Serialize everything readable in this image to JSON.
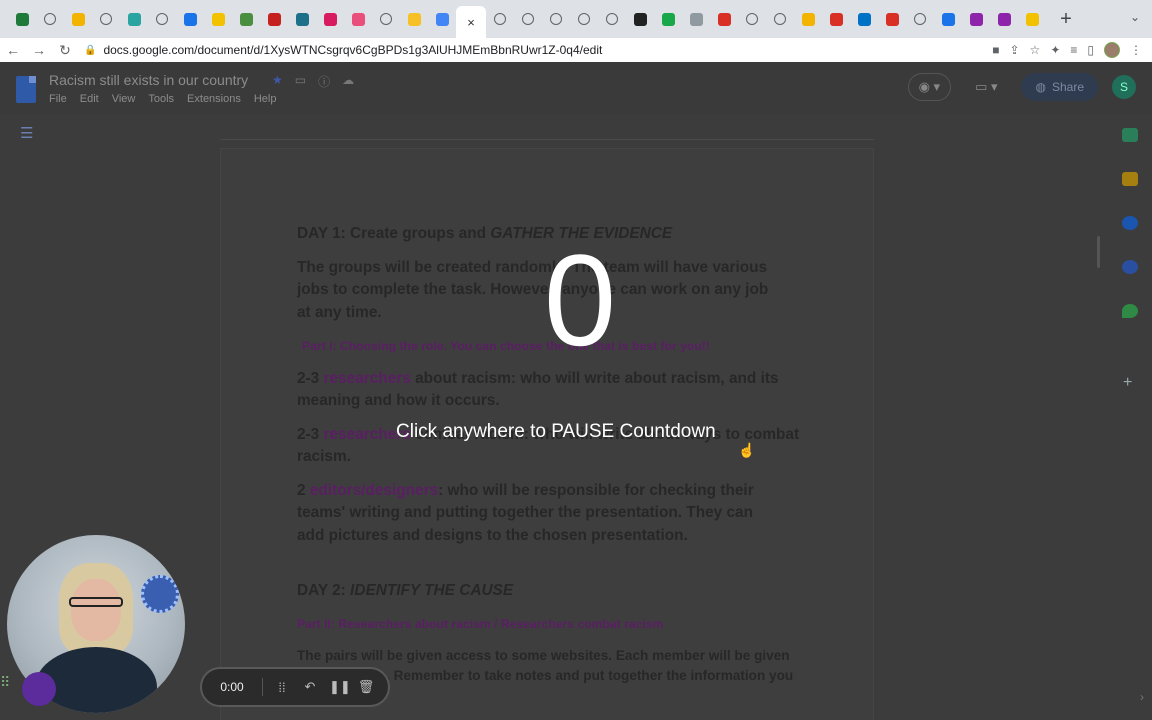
{
  "browser": {
    "url": "docs.google.com/document/d/1XysWTNCsgrqv6CgBPDs1g3AlUHJMEmBbnRUwr1Z-0q4/edit",
    "active_tab_close": "×",
    "new_tab": "+",
    "tab_search": "⌄",
    "nav": {
      "back": "←",
      "forward": "→",
      "reload": "↻"
    },
    "favicons": [
      "#1f7a3a",
      "ring",
      "#f2b400",
      "ring",
      "#2aa4a0",
      "ring",
      "#1a73e8",
      "#f2c200",
      "#4a8f3f",
      "#c5221f",
      "#1e6f8a",
      "#d81b60",
      "#e94f7a",
      "ring",
      "#f6c026",
      "#4285f4",
      "active",
      "ring",
      "ring",
      "ring",
      "ring",
      "ring",
      "#222222",
      "#18a84a",
      "#8e9aa0",
      "#d93025",
      "ring",
      "ring",
      "#f2b400",
      "#d93025",
      "#0072c6",
      "#d93025",
      "ring",
      "#1a73e8",
      "#8e24aa",
      "#8e24aa",
      "#f2c200"
    ]
  },
  "docs": {
    "title": "Racism still exists in our country",
    "menu": [
      "File",
      "Edit",
      "View",
      "Tools",
      "Extensions",
      "Help"
    ],
    "share_label": "Share",
    "avatar_letter": "S"
  },
  "content": {
    "day1_prefix": "DAY 1: Create groups and ",
    "day1_italic": "GATHER THE EVIDENCE",
    "para1": "The groups will be created randomly. The team will have various jobs to complete the task.  However, anyone can work on any job at any time.",
    "part1": "Part I: Choosing the role. You can choose the one that is best for you!!",
    "researchers_count": "2-3 ",
    "researchers_word": "researchers",
    "researchers_rest": " about racism: who will write about racism, and its meaning and how it occurs.",
    "researchers2_count": "2-3 ",
    "researchers2_word": "researchers",
    "researchers2_rest": " combat racism: who will write about ways to combat racism.",
    "editors_count": "2 ",
    "editors_word": "editors/designers",
    "editors_rest": ": who will be responsible for checking their teams' writing and putting together the presentation. They can add pictures and designs to the chosen presentation.",
    "day2_prefix": "DAY 2: ",
    "day2_italic": "IDENTIFY THE CAUSE",
    "part2": "Part II: Researchers about racism / Researchers combat racism",
    "para2": "The pairs will be given access to some websites. Each member will be given different links.  Remember to take notes and put together the information you find!"
  },
  "overlay": {
    "countdown": "0",
    "message": "Click anywhere to PAUSE Countdown"
  },
  "recorder": {
    "time": "0:00"
  }
}
